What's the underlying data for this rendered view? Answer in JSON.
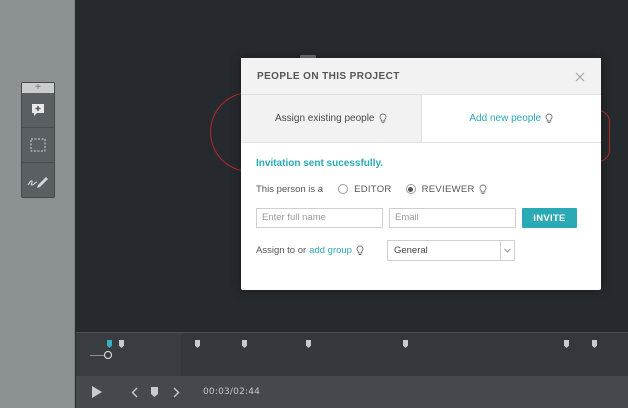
{
  "modal": {
    "title": "PEOPLE ON THIS PROJECT",
    "tabs": [
      {
        "label": "Assign existing people",
        "active": false
      },
      {
        "label": "Add new people",
        "active": true
      }
    ],
    "success_message": "Invitation sent sucessfully.",
    "role_prefix": "This person is a",
    "roles": [
      {
        "label": "EDITOR",
        "selected": false
      },
      {
        "label": "REVIEWER",
        "selected": true
      }
    ],
    "full_name_placeholder": "Enter full name",
    "email_placeholder": "Email",
    "invite_label": "INVITE",
    "assign_prefix": "Assign to or",
    "add_group_label": "add group",
    "group_select_value": "General"
  },
  "player": {
    "time": "00:03/02:44"
  },
  "toolbox": {
    "top_glyph": "+"
  },
  "colors": {
    "accent": "#2aaab5",
    "annotation": "#b32a2a"
  }
}
